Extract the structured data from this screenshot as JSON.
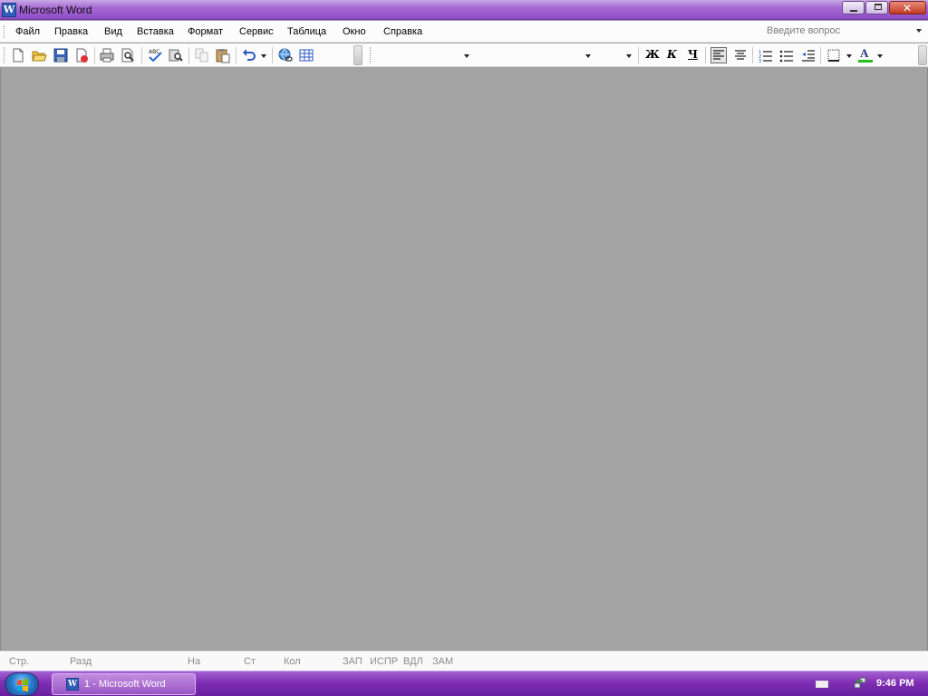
{
  "window": {
    "title": "Microsoft Word",
    "app_icon_letter": "W"
  },
  "menu": {
    "items": [
      {
        "label": "Файл"
      },
      {
        "label": "Правка"
      },
      {
        "label": "Вид"
      },
      {
        "label": "Вставка"
      },
      {
        "label": "Формат"
      },
      {
        "label": "Сервис"
      },
      {
        "label": "Таблица"
      },
      {
        "label": "Окно"
      },
      {
        "label": "Справка"
      }
    ],
    "help_placeholder": "Введите вопрос"
  },
  "toolbar": {
    "bold_label": "Ж",
    "italic_label": "К",
    "underline_label": "Ч",
    "font_color_label": "A",
    "style_value": "",
    "font_value": "",
    "size_value": ""
  },
  "statusbar": {
    "page": "Стр.",
    "section": "Разд",
    "at": "На",
    "line": "Ст",
    "column": "Кол",
    "rec": "ЗАП",
    "trk": "ИСПР",
    "ext": "ВДЛ",
    "ovr": "ЗАМ"
  },
  "taskbar": {
    "task_label": "1 - Microsoft Word",
    "task_icon_letter": "W",
    "clock": "9:46 PM"
  },
  "colors": {
    "titlebar": "#a66ad4",
    "taskbar": "#7e2fb3",
    "document_bg": "#a3a3a3"
  }
}
